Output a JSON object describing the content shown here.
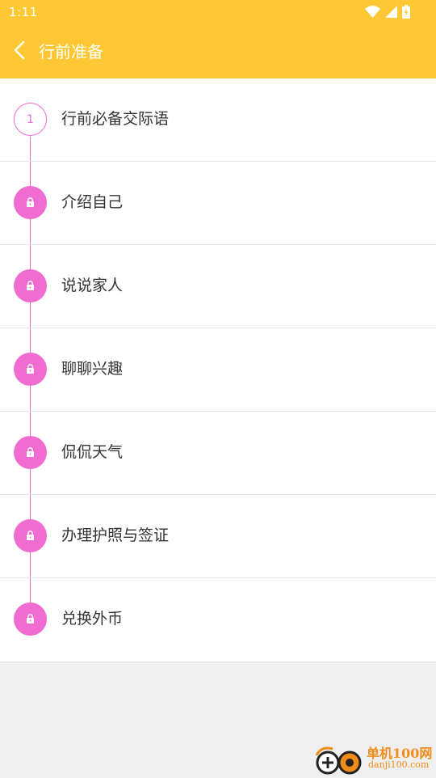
{
  "status_bar": {
    "time": "1:11",
    "icons": [
      "wifi-icon",
      "signal-icon",
      "battery-charging-icon"
    ]
  },
  "app_bar": {
    "back_icon": "chevron-left-icon",
    "title": "行前准备"
  },
  "lessons": [
    {
      "marker": "1",
      "label": "行前必备交际语",
      "locked": false
    },
    {
      "marker": "lock-icon",
      "label": "介绍自己",
      "locked": true
    },
    {
      "marker": "lock-icon",
      "label": "说说家人",
      "locked": true
    },
    {
      "marker": "lock-icon",
      "label": "聊聊兴趣",
      "locked": true
    },
    {
      "marker": "lock-icon",
      "label": "侃侃天气",
      "locked": true
    },
    {
      "marker": "lock-icon",
      "label": "办理护照与签证",
      "locked": true
    },
    {
      "marker": "lock-icon",
      "label": "兑换外币",
      "locked": true
    }
  ],
  "watermark": {
    "name": "单机100网",
    "url": "danji100.com"
  },
  "colors": {
    "header": "#ffc733",
    "accent": "#f06cd1",
    "text": "#333333",
    "background": "#efefef"
  }
}
